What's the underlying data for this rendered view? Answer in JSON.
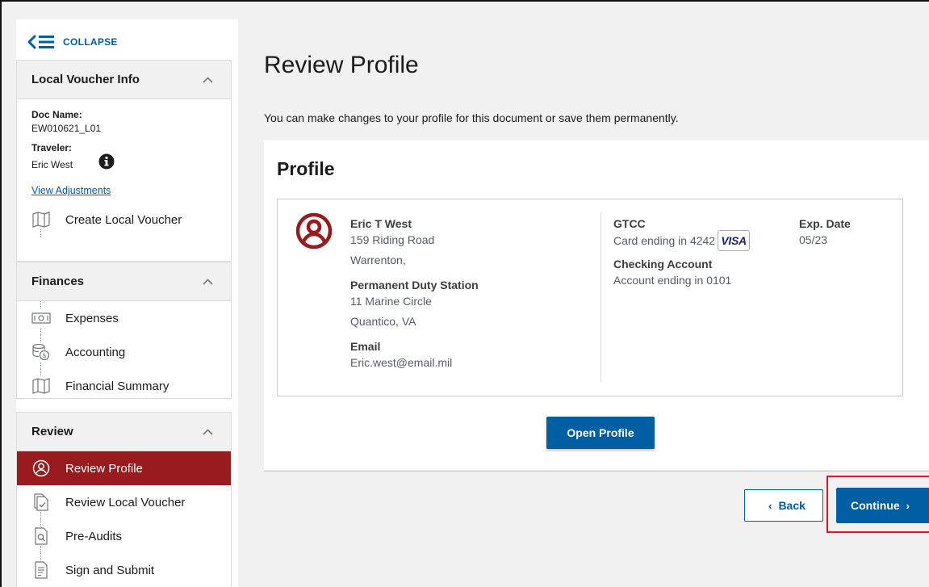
{
  "sidebar": {
    "collapse_label": "COLLAPSE",
    "local_voucher_info": {
      "title": "Local Voucher Info",
      "doc_name_label": "Doc Name:",
      "doc_name_value": "EW010621_L01",
      "traveler_label": "Traveler:",
      "traveler_value": "Eric West",
      "view_adjustments": "View Adjustments",
      "create_local_voucher": "Create Local Voucher"
    },
    "finances": {
      "title": "Finances",
      "items": [
        "Expenses",
        "Accounting",
        "Financial Summary"
      ]
    },
    "review": {
      "title": "Review",
      "items": [
        "Review Profile",
        "Review Local Voucher",
        "Pre-Audits",
        "Sign and Submit"
      ],
      "active_item": "Review Profile"
    }
  },
  "main": {
    "title": "Review Profile",
    "subtitle": "You can make changes to your profile for this document or save them permanently.",
    "card_title": "Profile",
    "profile": {
      "name": "Eric T West",
      "address_line1": "159 Riding Road",
      "address_line2": "Warrenton,",
      "pds_label": "Permanent Duty Station",
      "pds_line1": "11 Marine Circle",
      "pds_line2": "Quantico, VA",
      "email_label": "Email",
      "email_value": "Eric.west@email.mil",
      "gtcc_label": "GTCC",
      "gtcc_value": "Card ending in 4242",
      "card_brand": "VISA",
      "checking_label": "Checking Account",
      "checking_value": "Account ending in 0101",
      "exp_label": "Exp. Date",
      "exp_value": "05/23"
    },
    "open_profile_label": "Open Profile",
    "back_label": "Back",
    "continue_label": "Continue"
  },
  "colors": {
    "primary": "#005ea2",
    "active_nav": "#991b1e",
    "highlight_outline": "#e8141b",
    "visa_blue": "#1a1f71"
  }
}
